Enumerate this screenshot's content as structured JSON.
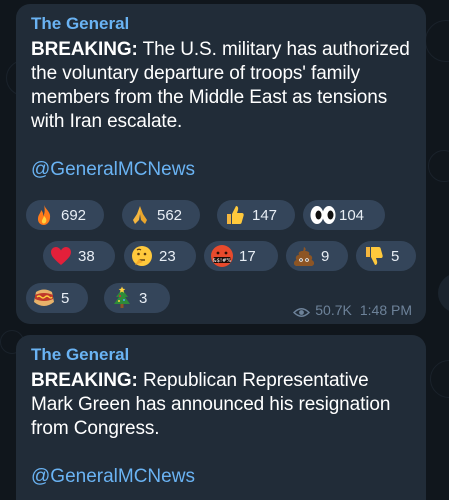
{
  "messages": [
    {
      "sender": "The General",
      "breaking_label": "BREAKING:",
      "body": " The U.S. military has authorized the voluntary departure of troops' family members from the Middle East as tensions with Iran escalate.",
      "handle": "@GeneralMCNews",
      "reactions": [
        {
          "emoji": "fire-emoji",
          "count": "692"
        },
        {
          "emoji": "folded-hands-emoji",
          "count": "562"
        },
        {
          "emoji": "thumbs-up-emoji",
          "count": "147"
        },
        {
          "emoji": "eyes-emoji",
          "count": "104"
        },
        {
          "emoji": "red-heart-emoji",
          "count": "38"
        },
        {
          "emoji": "thinking-face-emoji",
          "count": "23"
        },
        {
          "emoji": "face-with-symbols-emoji",
          "count": "17"
        },
        {
          "emoji": "poo-emoji",
          "count": "9"
        },
        {
          "emoji": "thumbs-down-emoji",
          "count": "5"
        },
        {
          "emoji": "hot-dog-emoji",
          "count": "5"
        },
        {
          "emoji": "christmas-tree-emoji",
          "count": "3"
        }
      ],
      "views": "50.7K",
      "time": "1:48 PM"
    },
    {
      "sender": "The General",
      "breaking_label": "BREAKING:",
      "body": " Republican Representative Mark Green has announced his resignation from Congress.",
      "handle": "@GeneralMCNews"
    }
  ],
  "colors": {
    "bubble": "#212c38",
    "accent": "#6ab3f3",
    "reaction_pill": "#34455a",
    "meta": "#6d8299"
  }
}
